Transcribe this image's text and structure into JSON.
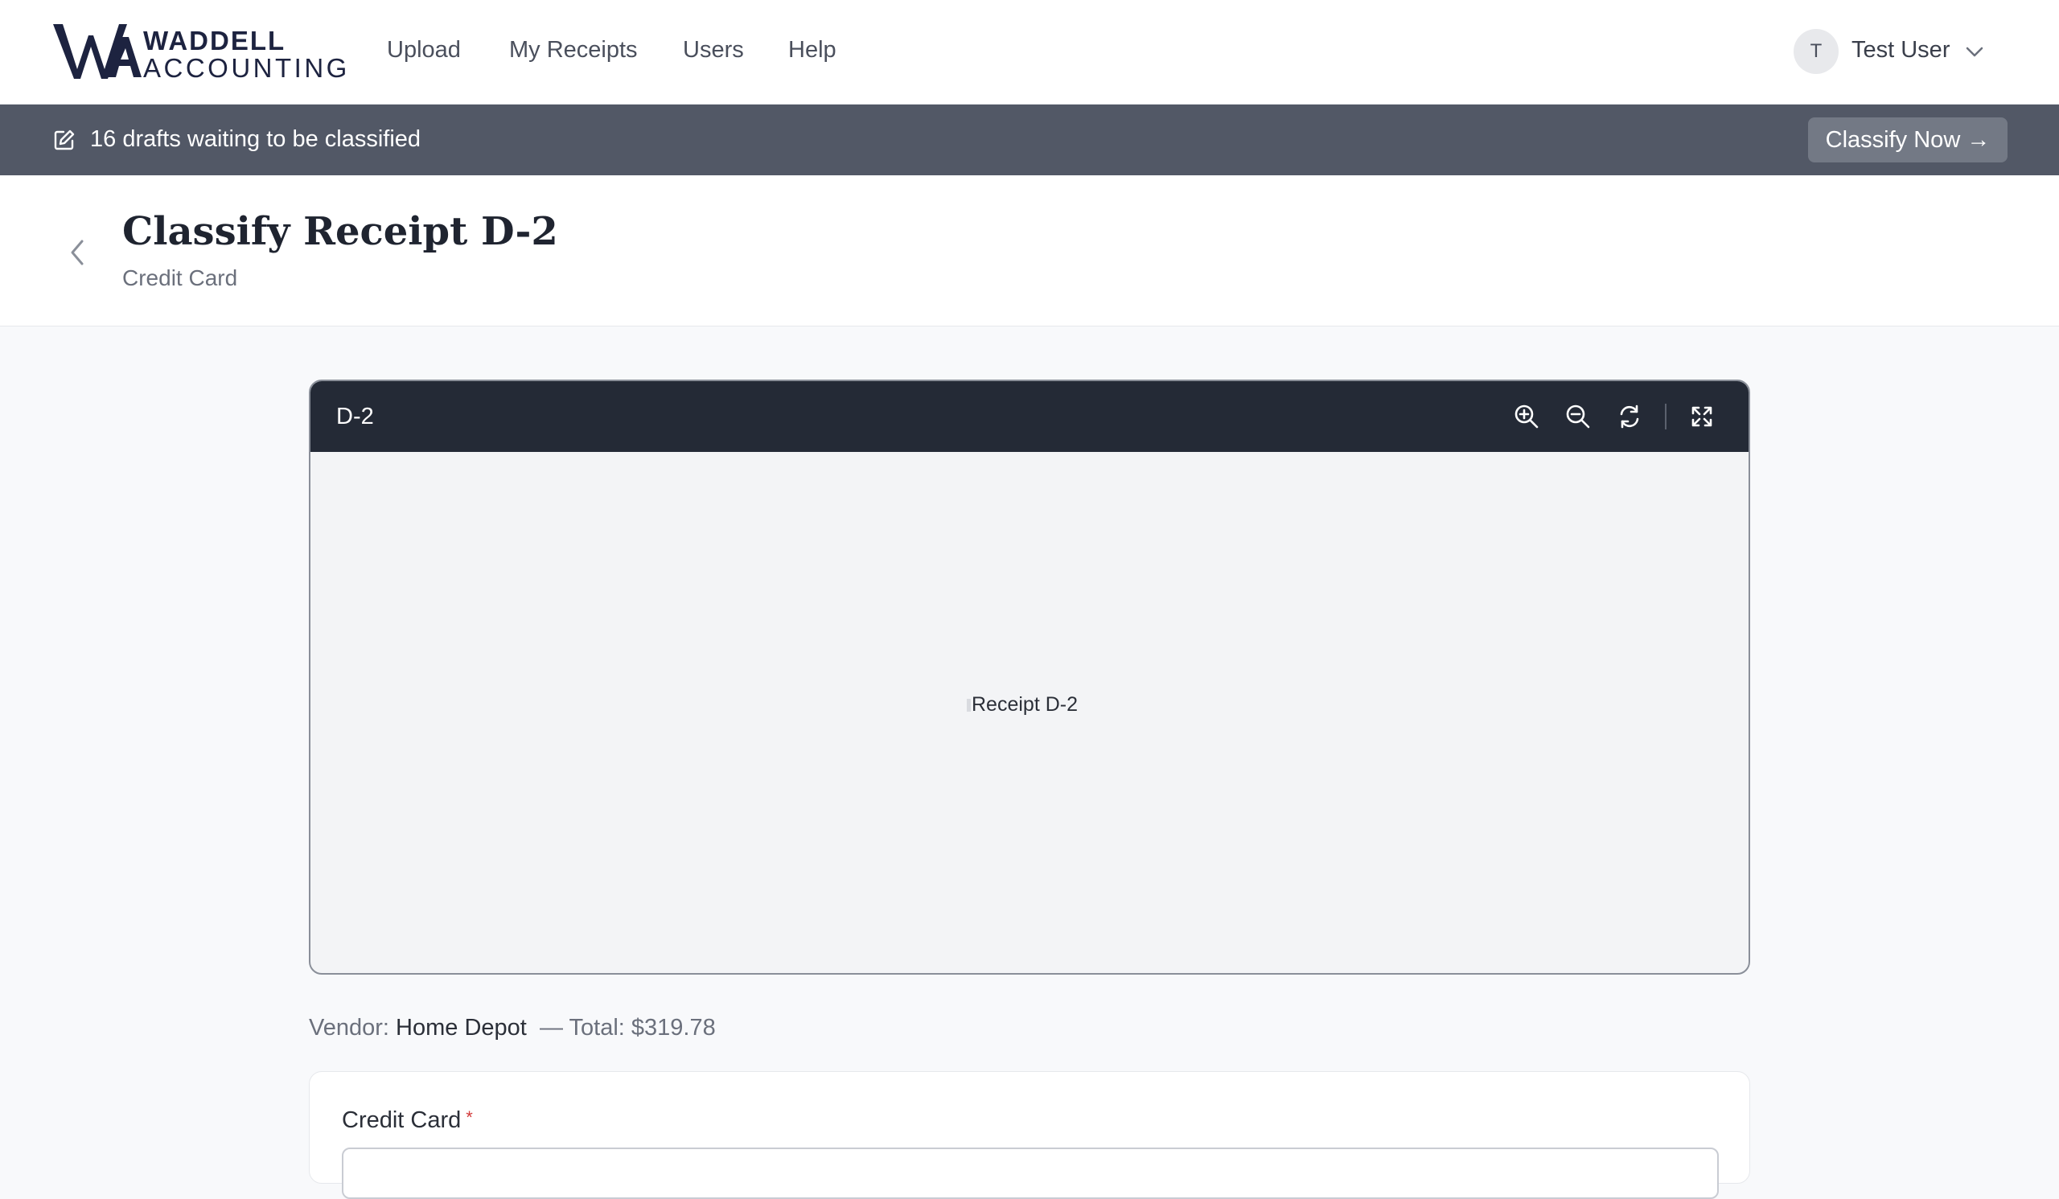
{
  "brand": {
    "line1": "WADDELL",
    "line2": "ACCOUNTING"
  },
  "nav": {
    "upload": "Upload",
    "my_receipts": "My Receipts",
    "users": "Users",
    "help": "Help"
  },
  "user": {
    "initial": "T",
    "name": "Test User"
  },
  "banner": {
    "message": "16 drafts waiting to be classified",
    "action": "Classify Now →"
  },
  "page": {
    "title": "Classify Receipt D-2",
    "subtitle": "Credit Card"
  },
  "viewer": {
    "file_name": "D-2",
    "image_alt": "Receipt D-2",
    "tools": [
      "zoom-in-icon",
      "zoom-out-icon",
      "rotate-icon",
      "fullscreen-icon"
    ]
  },
  "details": {
    "vendor_label": "Vendor:",
    "vendor": "Home Depot",
    "total_text": "— Total: $319.78"
  },
  "form": {
    "credit_card_label": "Credit Card",
    "required_mark": "*"
  },
  "colors": {
    "banner_bg": "#525866",
    "viewer_bar": "#242a36",
    "brand": "#1d2340",
    "required": "#d23a3a"
  }
}
